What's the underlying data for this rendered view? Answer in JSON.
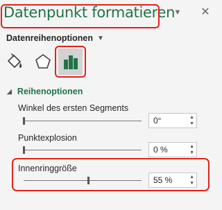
{
  "header": {
    "title": "Datenpunkt formatieren",
    "dropdown_icon": "▼",
    "close_icon": "✕"
  },
  "options_menu": {
    "label": "Datenreihenoptionen",
    "caret": "▼"
  },
  "tabs": [
    {
      "name": "fill-line",
      "icon": "paint-bucket-icon"
    },
    {
      "name": "effects",
      "icon": "pentagon-icon"
    },
    {
      "name": "series-options",
      "icon": "bar-chart-icon",
      "selected": true
    }
  ],
  "section": {
    "toggle": "◢",
    "label": "Reihenoptionen"
  },
  "fields": {
    "angle": {
      "label": "Winkel des ersten Segments",
      "value": "0°",
      "level": 0
    },
    "explosion": {
      "label": "Punktexplosion",
      "value": "0 %",
      "level": 0
    },
    "hole": {
      "label": "Innenringgröße",
      "value": "55 %",
      "level": 0.55
    }
  },
  "colors": {
    "accent": "#217346",
    "highlight": "#e2231a"
  }
}
